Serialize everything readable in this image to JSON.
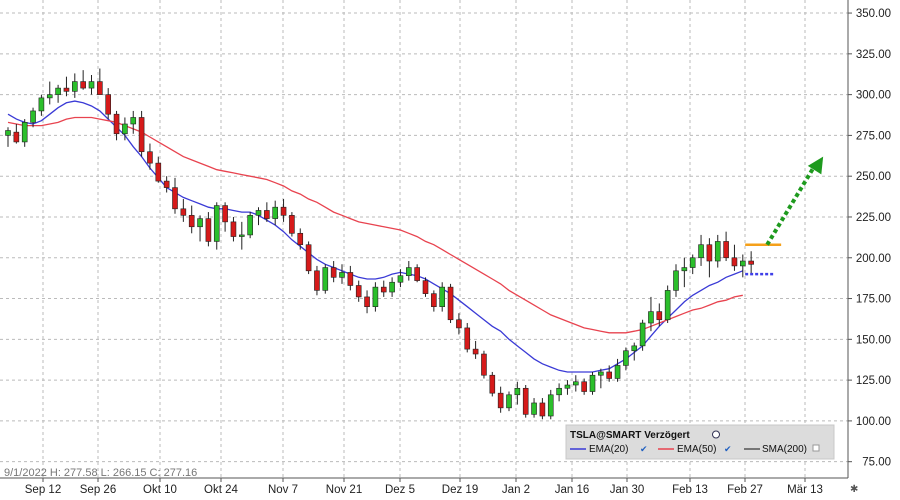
{
  "chart_data": {
    "type": "candlestick",
    "y_ticks": [
      75,
      100,
      125,
      150,
      175,
      200,
      225,
      250,
      275,
      300,
      325,
      350
    ],
    "y_tick_labels": [
      "75.00",
      "100.00",
      "125.00",
      "150.00",
      "175.00",
      "200.00",
      "225.00",
      "250.00",
      "275.00",
      "300.00",
      "325.00",
      "350.00"
    ],
    "x_tick_labels": [
      "Sep 12",
      "Sep 26",
      "Okt 10",
      "Okt 24",
      "Nov 7",
      "Nov 21",
      "Dez 5",
      "Dez 19",
      "Jan 2",
      "Jan 16",
      "Jan 30",
      "Feb 13",
      "Feb 27",
      "Mär 13"
    ],
    "ylim": [
      65,
      358
    ],
    "ohlc_readout": "9/1/2022  H: 277.58  L: 266.15  C: 277.16",
    "legend": {
      "title": "TSLA@SMART Verzögert",
      "items": [
        "EMA(20)",
        "EMA(50)",
        "SMA(200)"
      ]
    },
    "series": [
      {
        "name": "EMA(20)",
        "color": "#3a3ad6",
        "values": [
          288,
          285,
          283,
          282,
          284,
          288,
          292,
          295,
          296,
          295,
          293,
          290,
          285,
          280,
          275,
          268,
          262,
          255,
          249,
          243,
          240,
          237,
          235,
          233,
          231,
          230,
          230,
          229,
          228,
          228,
          226,
          223,
          220,
          216,
          211,
          207,
          203,
          199,
          196,
          194,
          192,
          190,
          188,
          187,
          187,
          188,
          190,
          191,
          190,
          189,
          187,
          184,
          181,
          178,
          174,
          170,
          166,
          162,
          158,
          155,
          150,
          146,
          142,
          138,
          135,
          133,
          131,
          130,
          130,
          130,
          130,
          131,
          132,
          135,
          138,
          142,
          146,
          152,
          158,
          163,
          168,
          173,
          177,
          180,
          183,
          185,
          188,
          190,
          192
        ]
      },
      {
        "name": "EMA(50)",
        "color": "#e8434f",
        "values": [
          283,
          282,
          281,
          281,
          281,
          282,
          283,
          285,
          286,
          286,
          286,
          285,
          284,
          283,
          281,
          279,
          277,
          274,
          271,
          268,
          265,
          262,
          260,
          258,
          256,
          254,
          253,
          252,
          251,
          250,
          249,
          248,
          246,
          244,
          241,
          239,
          236,
          234,
          231,
          228,
          226,
          224,
          222,
          221,
          220,
          219,
          218,
          217,
          215,
          213,
          210,
          208,
          205,
          202,
          199,
          196,
          193,
          190,
          187,
          184,
          180,
          177,
          174,
          171,
          168,
          165,
          163,
          161,
          159,
          157,
          156,
          155,
          154,
          154,
          154,
          155,
          156,
          158,
          160,
          162,
          164,
          166,
          168,
          169,
          171,
          173,
          174,
          176,
          177
        ]
      }
    ],
    "candles": [
      [
        275,
        280,
        268,
        278
      ],
      [
        277,
        282,
        270,
        271
      ],
      [
        271,
        285,
        268,
        283
      ],
      [
        283,
        292,
        280,
        290
      ],
      [
        290,
        300,
        287,
        298
      ],
      [
        298,
        308,
        294,
        300
      ],
      [
        300,
        306,
        295,
        304
      ],
      [
        304,
        311,
        299,
        302
      ],
      [
        302,
        313,
        298,
        308
      ],
      [
        308,
        315,
        303,
        304
      ],
      [
        304,
        312,
        300,
        308
      ],
      [
        308,
        316,
        302,
        300
      ],
      [
        300,
        304,
        285,
        288
      ],
      [
        288,
        290,
        272,
        276
      ],
      [
        276,
        286,
        272,
        282
      ],
      [
        282,
        290,
        276,
        286
      ],
      [
        286,
        290,
        262,
        265
      ],
      [
        265,
        270,
        254,
        258
      ],
      [
        258,
        262,
        246,
        247
      ],
      [
        247,
        250,
        240,
        243
      ],
      [
        243,
        249,
        227,
        230
      ],
      [
        230,
        236,
        222,
        226
      ],
      [
        226,
        232,
        215,
        219
      ],
      [
        219,
        226,
        210,
        224
      ],
      [
        224,
        228,
        207,
        210
      ],
      [
        210,
        234,
        205,
        232
      ],
      [
        232,
        234,
        216,
        222
      ],
      [
        222,
        225,
        210,
        213
      ],
      [
        213,
        222,
        205,
        214
      ],
      [
        214,
        228,
        212,
        226
      ],
      [
        226,
        231,
        220,
        229
      ],
      [
        229,
        234,
        222,
        224
      ],
      [
        224,
        235,
        220,
        231
      ],
      [
        231,
        236,
        222,
        226
      ],
      [
        226,
        228,
        213,
        215
      ],
      [
        215,
        218,
        205,
        208
      ],
      [
        208,
        210,
        190,
        192
      ],
      [
        192,
        195,
        177,
        180
      ],
      [
        180,
        196,
        178,
        194
      ],
      [
        194,
        198,
        185,
        188
      ],
      [
        188,
        196,
        184,
        191
      ],
      [
        191,
        195,
        180,
        183
      ],
      [
        183,
        186,
        173,
        176
      ],
      [
        176,
        180,
        166,
        170
      ],
      [
        170,
        185,
        167,
        182
      ],
      [
        182,
        186,
        176,
        179
      ],
      [
        179,
        188,
        176,
        185
      ],
      [
        185,
        193,
        182,
        189
      ],
      [
        189,
        198,
        186,
        194
      ],
      [
        194,
        196,
        185,
        186
      ],
      [
        186,
        188,
        176,
        178
      ],
      [
        178,
        180,
        167,
        170
      ],
      [
        170,
        185,
        167,
        182
      ],
      [
        182,
        184,
        160,
        162
      ],
      [
        162,
        166,
        153,
        157
      ],
      [
        157,
        160,
        142,
        144
      ],
      [
        144,
        149,
        138,
        141
      ],
      [
        141,
        143,
        126,
        128
      ],
      [
        128,
        130,
        115,
        117
      ],
      [
        117,
        121,
        105,
        108
      ],
      [
        108,
        118,
        106,
        116
      ],
      [
        116,
        124,
        110,
        120
      ],
      [
        120,
        122,
        102,
        104
      ],
      [
        104,
        114,
        102,
        111
      ],
      [
        111,
        114,
        101,
        103
      ],
      [
        103,
        119,
        101,
        116
      ],
      [
        116,
        123,
        112,
        120
      ],
      [
        120,
        125,
        116,
        122
      ],
      [
        122,
        128,
        118,
        124
      ],
      [
        124,
        126,
        116,
        118
      ],
      [
        118,
        130,
        116,
        128
      ],
      [
        128,
        132,
        120,
        130
      ],
      [
        130,
        134,
        124,
        126
      ],
      [
        126,
        138,
        124,
        134
      ],
      [
        134,
        145,
        131,
        143
      ],
      [
        143,
        148,
        137,
        146
      ],
      [
        146,
        162,
        143,
        160
      ],
      [
        160,
        176,
        155,
        167
      ],
      [
        167,
        172,
        158,
        162
      ],
      [
        162,
        183,
        160,
        180
      ],
      [
        180,
        196,
        176,
        192
      ],
      [
        192,
        200,
        182,
        194
      ],
      [
        194,
        202,
        190,
        200
      ],
      [
        200,
        214,
        195,
        208
      ],
      [
        208,
        212,
        188,
        198
      ],
      [
        198,
        214,
        194,
        210
      ],
      [
        210,
        216,
        198,
        200
      ],
      [
        200,
        208,
        192,
        195
      ],
      [
        195,
        202,
        188,
        198
      ],
      [
        198,
        204,
        190,
        196
      ]
    ],
    "annotations": {
      "target_line": {
        "value": 208,
        "color": "#f5a01a"
      },
      "support_line": {
        "value": 190,
        "color": "#4040e8"
      },
      "arrow": {
        "from": 208,
        "to": 262,
        "color": "#1e9a1e"
      }
    },
    "colors": {
      "up": "#2bbf2b",
      "down": "#d61a1a",
      "grid": "#bbbbbb",
      "wick": "#222222"
    }
  }
}
